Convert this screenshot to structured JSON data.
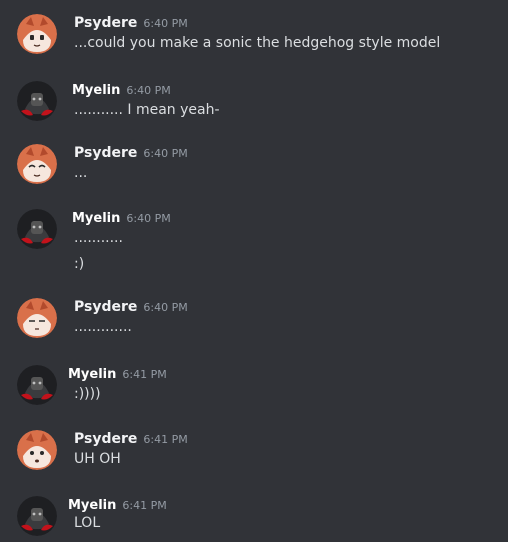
{
  "messages": [
    {
      "author": "Psydere",
      "time": "6:40 PM",
      "lines": [
        "...could you make a sonic the hedgehog style model"
      ]
    },
    {
      "author": "Myelin",
      "time": "6:40 PM",
      "lines": [
        "........... I mean yeah-"
      ]
    },
    {
      "author": "Psydere",
      "time": "6:40 PM",
      "lines": [
        "..."
      ]
    },
    {
      "author": "Myelin",
      "time": "6:40 PM",
      "lines": [
        "...........",
        ":)"
      ]
    },
    {
      "author": "Psydere",
      "time": "6:40 PM",
      "lines": [
        "............."
      ]
    },
    {
      "author": "Myelin",
      "time": "6:41 PM",
      "lines": [
        ":))))"
      ]
    },
    {
      "author": "Psydere",
      "time": "6:41 PM",
      "lines": [
        "UH OH"
      ]
    },
    {
      "author": "Myelin",
      "time": "6:41 PM",
      "lines": [
        "LOL"
      ]
    }
  ],
  "colors": {
    "background": "#313338",
    "username": "#f2f3f5",
    "timestamp": "#949ba4",
    "message_text": "#dbdee1"
  },
  "icons": {
    "psydere_avatar": "fox-face-avatar",
    "myelin_avatar": "dark-red-character-avatar"
  }
}
